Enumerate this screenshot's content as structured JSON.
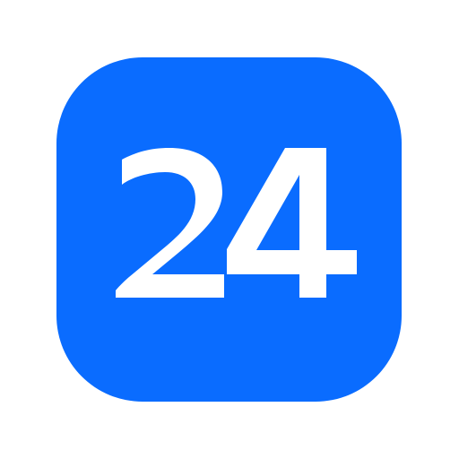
{
  "icon": {
    "name": "app-icon-24",
    "text": "24",
    "colors": {
      "background": "#ffffff",
      "tile": "#0a6cff",
      "glyph": "#ffffff"
    }
  }
}
